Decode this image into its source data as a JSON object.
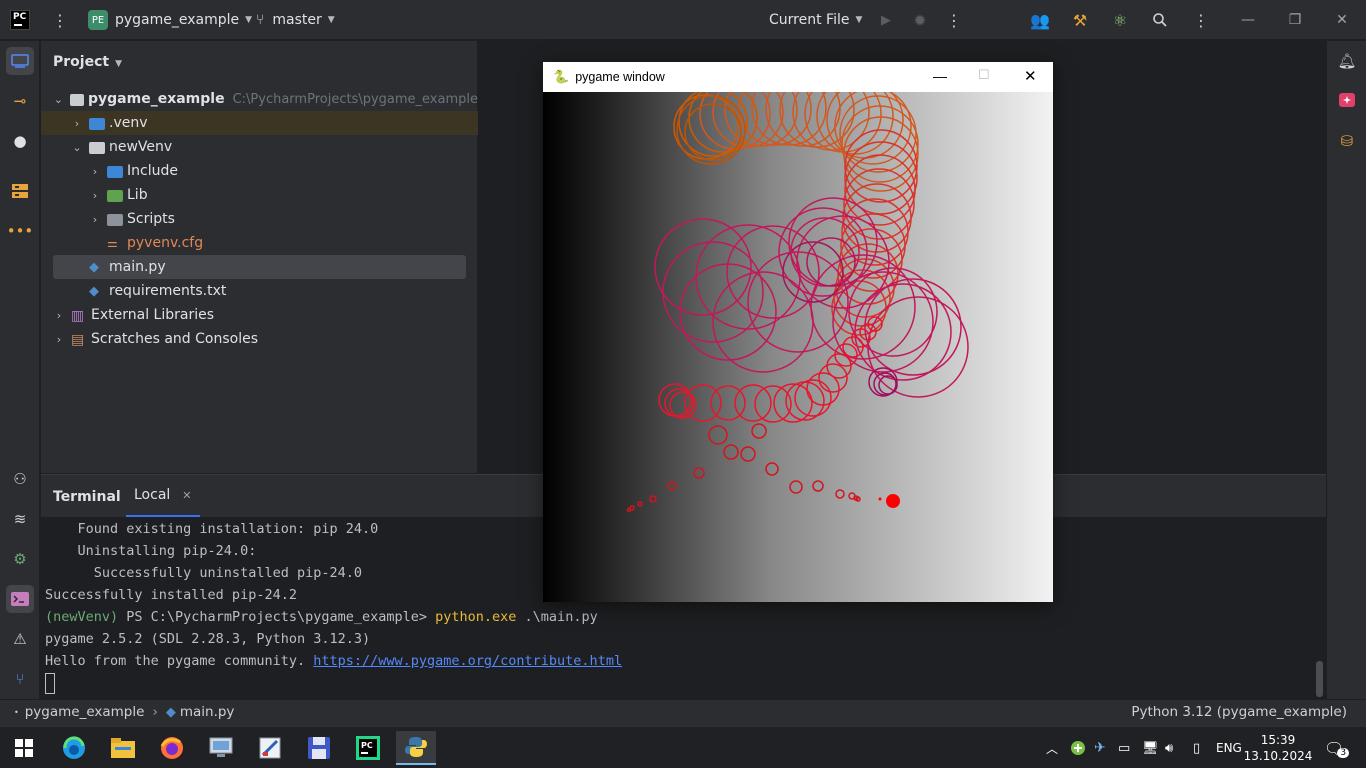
{
  "titlebar": {
    "app_logo": "PC",
    "project_badge": "PE",
    "project_name": "pygame_example",
    "branch": "master",
    "run_config": "Current File"
  },
  "project_panel": {
    "title": "Project",
    "tree": [
      {
        "label": "pygame_example",
        "hint": "C:\\PycharmProjects\\pygame_example"
      },
      {
        "label": ".venv"
      },
      {
        "label": "newVenv"
      },
      {
        "label": "Include"
      },
      {
        "label": "Lib"
      },
      {
        "label": "Scripts"
      },
      {
        "label": "pyvenv.cfg"
      },
      {
        "label": "main.py"
      },
      {
        "label": "requirements.txt"
      },
      {
        "label": "External Libraries"
      },
      {
        "label": "Scratches and Consoles"
      }
    ]
  },
  "terminal": {
    "title": "Terminal",
    "tab": "Local",
    "lines": {
      "l1": "    Found existing installation: pip 24.0",
      "l2": "    Uninstalling pip-24.0:",
      "l3": "      Successfully uninstalled pip-24.0",
      "l4": "Successfully installed pip-24.2",
      "prompt_venv": "(newVenv)",
      "prompt_path": " PS C:\\PycharmProjects\\pygame_example> ",
      "prompt_cmd": "python.exe",
      "prompt_arg": " .\\main.py",
      "l6": "pygame 2.5.2 (SDL 2.28.3, Python 3.12.3)",
      "l7_prefix": "Hello from the pygame community. ",
      "l7_link": "https://www.pygame.org/contribute.html"
    }
  },
  "statusbar": {
    "crumb_project": "pygame_example",
    "crumb_file": "main.py",
    "interpreter": "Python 3.12 (pygame_example)"
  },
  "pygame_window": {
    "title": "pygame window"
  },
  "taskbar": {
    "language": "ENG",
    "time": "15:39",
    "date": "13.10.2024",
    "notifications": "3"
  }
}
